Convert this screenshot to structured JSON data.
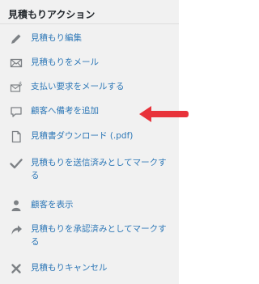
{
  "panel": {
    "title": "見積もりアクション",
    "actions": [
      {
        "id": "edit",
        "icon": "pencil-icon",
        "label": "見積もり編集"
      },
      {
        "id": "email",
        "icon": "envelope-icon",
        "label": "見積もりをメール"
      },
      {
        "id": "payment-request",
        "icon": "envelope-dollar-icon",
        "label": "支払い要求をメールする"
      },
      {
        "id": "add-note",
        "icon": "speech-bubble-icon",
        "label": "顧客へ備考を追加"
      },
      {
        "id": "download",
        "icon": "document-icon",
        "label": "見積書ダウンロード (.pdf)"
      },
      {
        "id": "mark-sent",
        "icon": "checkmark-icon",
        "label": "見積もりを送信済みとしてマークする"
      },
      {
        "id": "view-customer",
        "icon": "person-icon",
        "label": "顧客を表示"
      },
      {
        "id": "mark-accepted",
        "icon": "share-arrow-icon",
        "label": "見積もりを承認済みとしてマークする"
      },
      {
        "id": "cancel",
        "icon": "x-icon",
        "label": "見積もりキャンセル"
      }
    ]
  },
  "colors": {
    "panel_bg": "#f1f1f1",
    "link": "#2e78b7",
    "icon": "#7d8185",
    "highlight_arrow": "#e8323a"
  }
}
